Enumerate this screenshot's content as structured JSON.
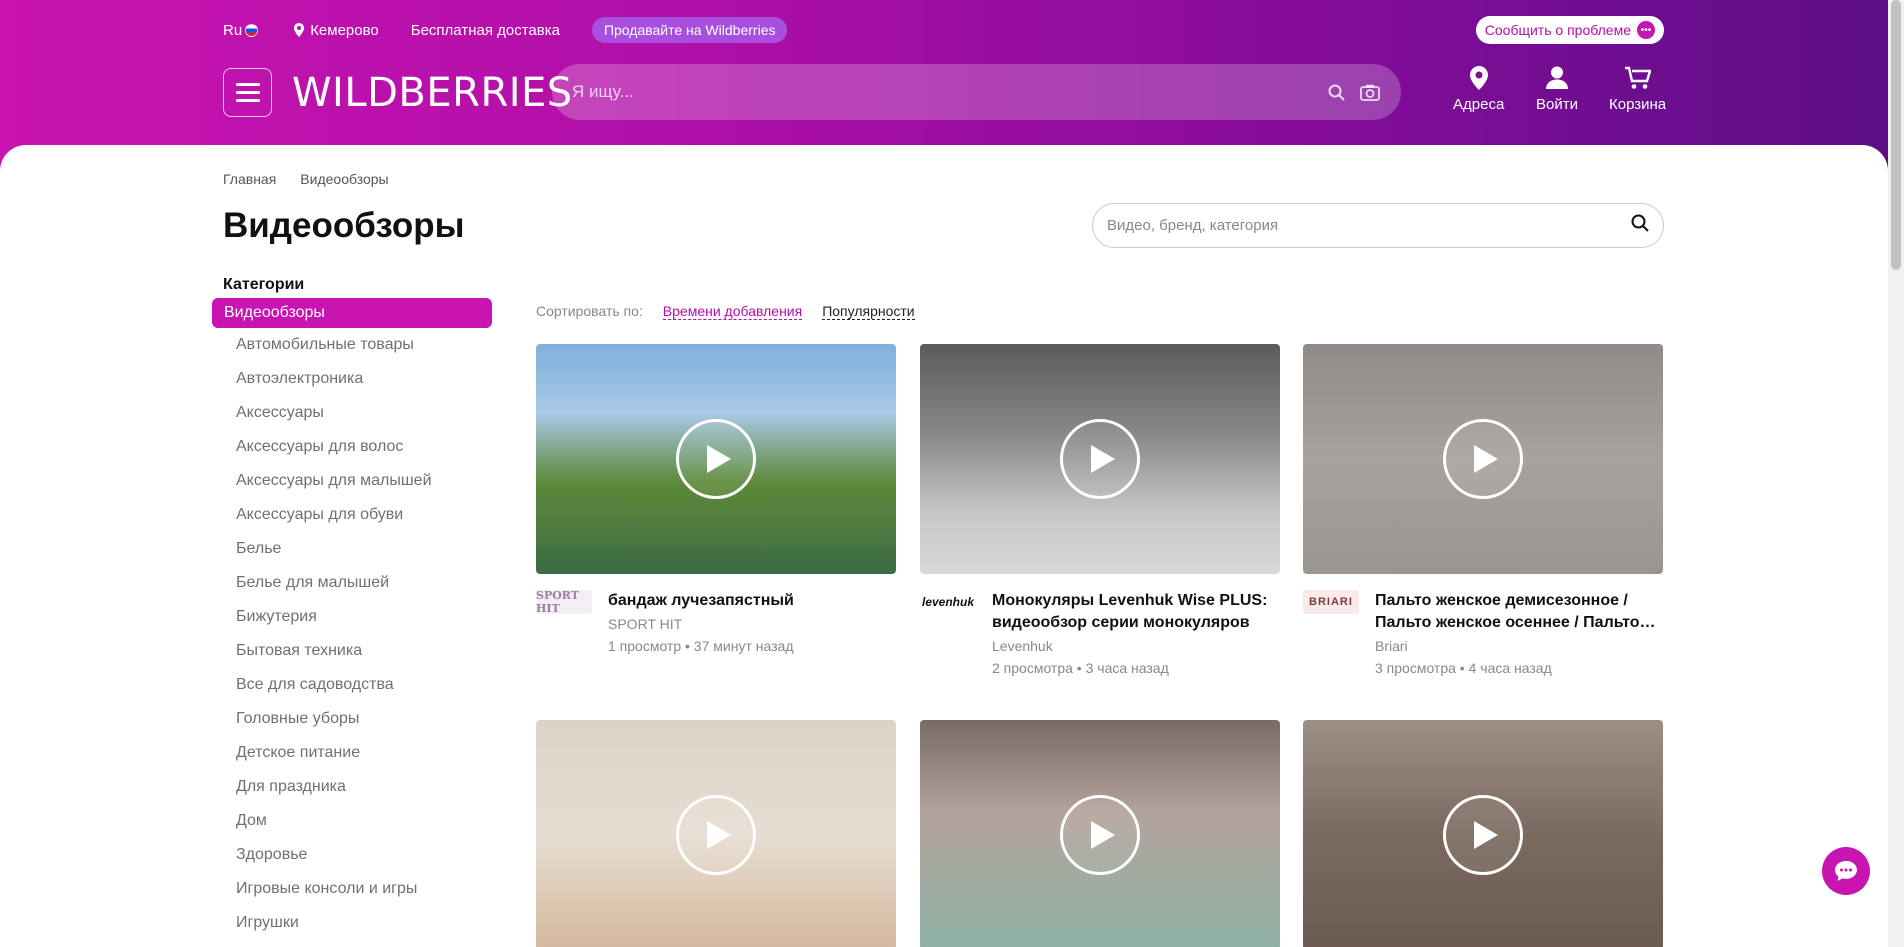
{
  "header": {
    "lang": "Ru",
    "city": "Кемерово",
    "delivery": "Бесплатная доставка",
    "sell": "Продавайте на Wildberries",
    "report": "Сообщить о проблеме",
    "logo": "WILDBERRIES",
    "search_placeholder": "Я ищу...",
    "nav": {
      "addresses": "Адреса",
      "login": "Войти",
      "cart": "Корзина"
    }
  },
  "breadcrumbs": [
    "Главная",
    "Видеообзоры"
  ],
  "page_title": "Видеообзоры",
  "video_search_placeholder": "Видео, бренд, категория",
  "sidebar": {
    "title": "Категории",
    "active": "Видеообзоры",
    "items": [
      "Автомобильные товары",
      "Автоэлектроника",
      "Аксессуары",
      "Аксессуары для волос",
      "Аксессуары для малышей",
      "Аксессуары для обуви",
      "Белье",
      "Белье для малышей",
      "Бижутерия",
      "Бытовая техника",
      "Все для садоводства",
      "Головные уборы",
      "Детское питание",
      "Для праздника",
      "Дом",
      "Здоровье",
      "Игровые консоли и игры",
      "Игрушки"
    ]
  },
  "sort": {
    "label": "Сортировать по:",
    "by_date": "Времени добавления",
    "by_popularity": "Популярности"
  },
  "videos": [
    {
      "title": "бандаж лучезапястный",
      "brand": "SPORT HIT",
      "stats": "1 просмотр • 37 минут назад",
      "logo_text": "SPORT HIT"
    },
    {
      "title": "Монокуляры Levenhuk Wise PLUS: видеообзор серии монокуляров",
      "brand": "Levenhuk",
      "stats": "2 просмотра • 3 часа назад",
      "logo_text": "levenhuk"
    },
    {
      "title": "Пальто женское демисезонное / Пальто женское осеннее / Пальто…",
      "brand": "Briari",
      "stats": "3 просмотра • 4 часа назад",
      "logo_text": "BRIARI"
    }
  ],
  "colors": {
    "brand": "#c814b0",
    "brand_dark": "#5b0e86",
    "accent_link": "#b10fa9"
  }
}
